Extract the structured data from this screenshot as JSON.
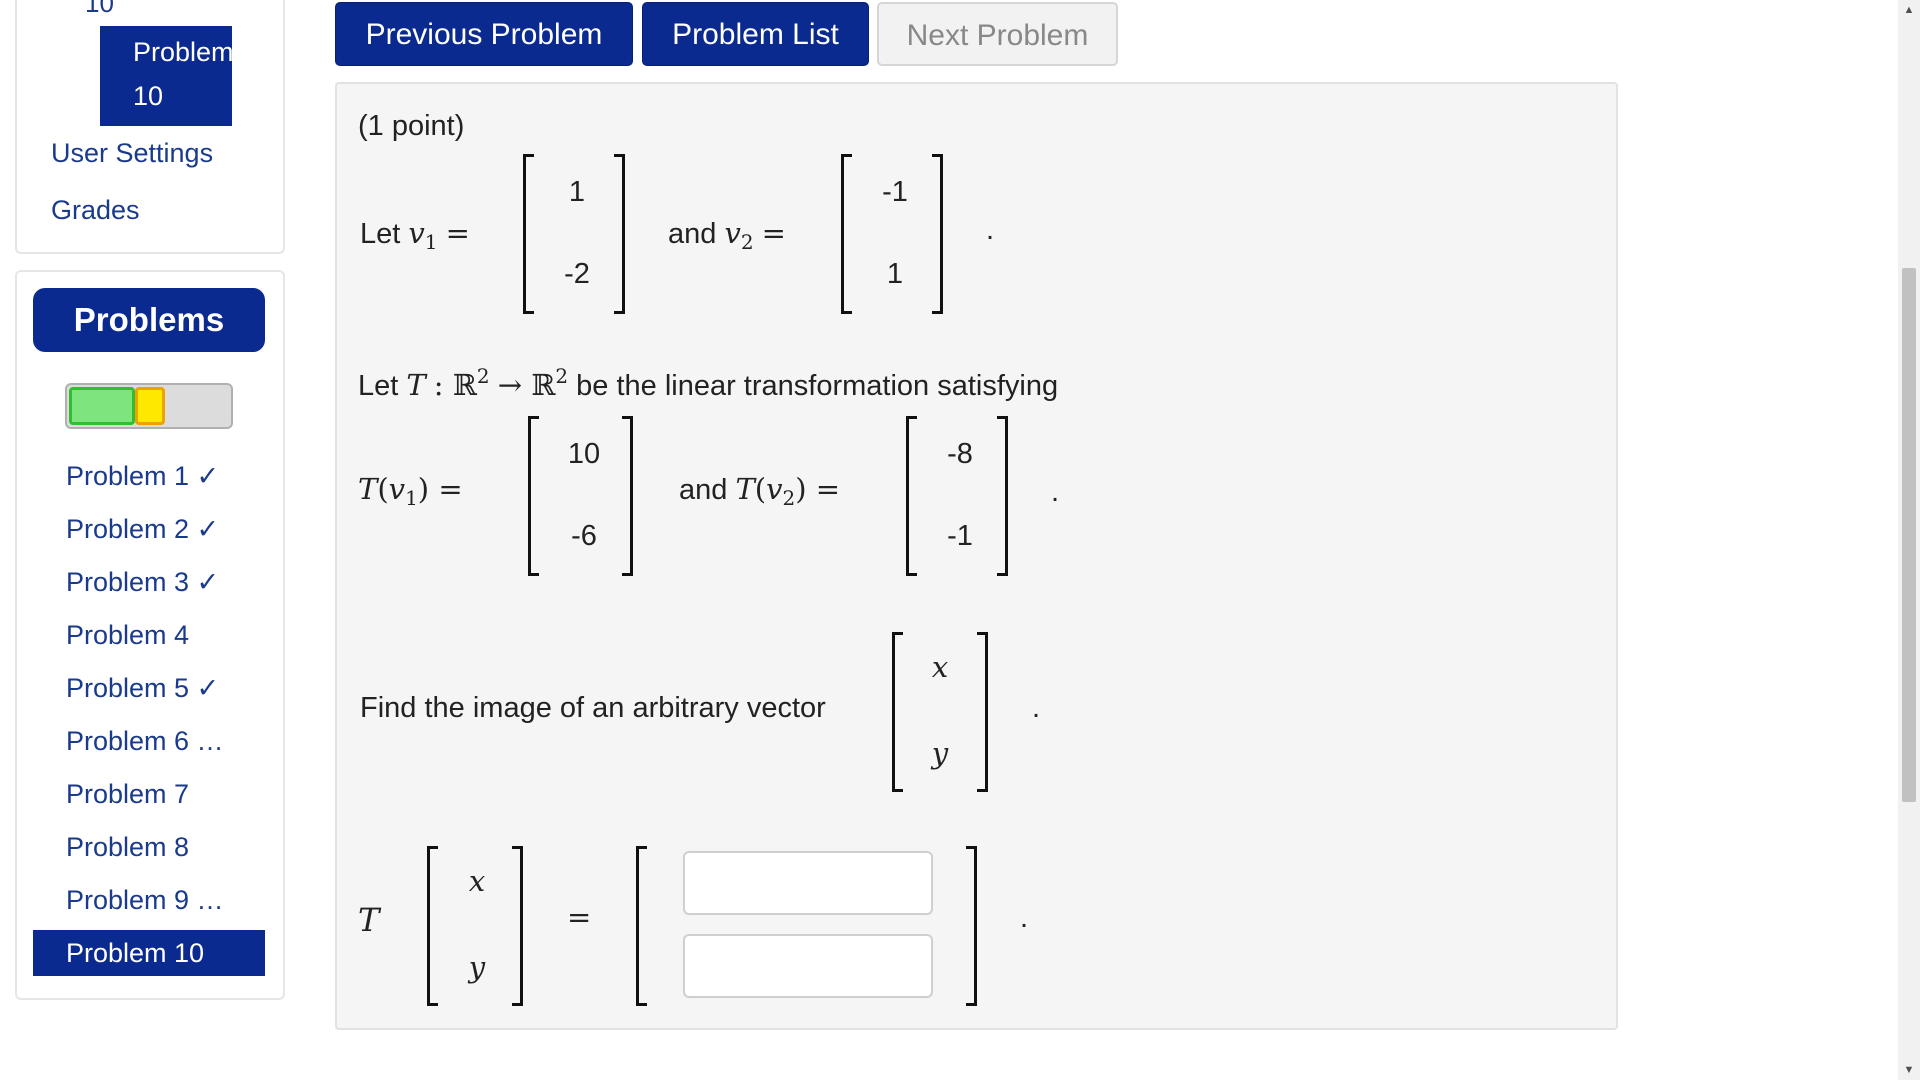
{
  "sidebar": {
    "top": {
      "partial_label": "10",
      "active_item": [
        "Problem",
        "10"
      ],
      "links": [
        "User Settings",
        "Grades"
      ]
    },
    "problems_button": "Problems",
    "progress": {
      "correct_fraction": 0.4,
      "partial_fraction": 0.1,
      "colors": {
        "correct": "#7ee57e",
        "partial": "#ffe800",
        "remaining": "#dcdcdc"
      }
    },
    "problem_list": [
      "Problem 1 ✓",
      "Problem 2 ✓",
      "Problem 3 ✓",
      "Problem 4",
      "Problem 5 ✓",
      "Problem 6 …",
      "Problem 7",
      "Problem 8",
      "Problem 9 …",
      "Problem 10"
    ],
    "current_problem_index": 9
  },
  "toolbar": {
    "previous_label": "Previous Problem",
    "list_label": "Problem List",
    "next_label": "Next Problem"
  },
  "problem": {
    "points": "(1 point)",
    "let_word": "Let",
    "and_word": "and",
    "v1_symbol": "v",
    "v1_sub": "1",
    "v2_symbol": "v",
    "v2_sub": "2",
    "v1": [
      "1",
      "-2"
    ],
    "v2": [
      "-1",
      "1"
    ],
    "transform_intro_pre": "Let",
    "transform_symbol": "T",
    "transform_domain": "ℝ",
    "transform_codomain": "ℝ",
    "transform_dim": "2",
    "transform_desc": "be the linear transformation satisfying",
    "Tv1": [
      "10",
      "-6"
    ],
    "Tv2": [
      "-8",
      "-1"
    ],
    "find_text": "Find the image of an arbitrary vector",
    "arbitrary_vector": [
      "x",
      "y"
    ],
    "answer_inputs": {
      "top": "",
      "bottom": ""
    },
    "period": "."
  },
  "colors": {
    "primary": "#0b2a8f",
    "link": "#1a3a8c",
    "panel_bg": "#f5f5f5"
  }
}
